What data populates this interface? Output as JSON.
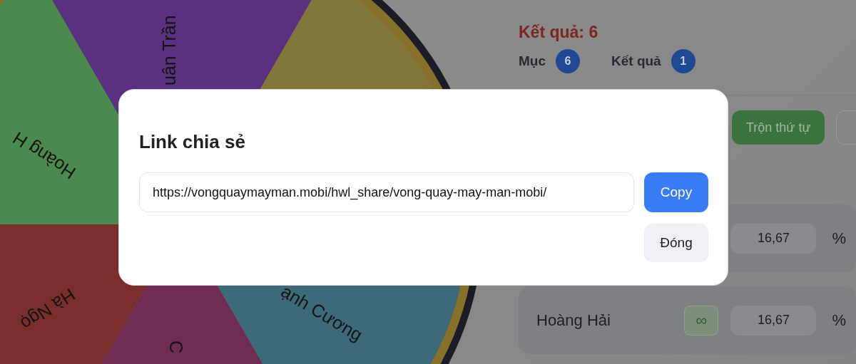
{
  "wheel": {
    "slices": [
      {
        "color": "#4a8a4e",
        "label": "Hoàng H"
      },
      {
        "color": "#5a317e",
        "label": "uân Trần"
      },
      {
        "color": "#81773a"
      },
      {
        "color": "#3c6a78",
        "label": "ạnh Cương"
      },
      {
        "color": "#6f2c52",
        "label": "C"
      },
      {
        "color": "#7a2e2b",
        "label": "Hà Ngọ"
      }
    ]
  },
  "result": {
    "title": "Kết quả: 6"
  },
  "counters": [
    {
      "label": "Mục",
      "count": "6"
    },
    {
      "label": "Kết quả",
      "count": "1"
    }
  ],
  "actions": [
    {
      "label": "Trộn thứ tự",
      "kind": "shuffle"
    },
    {
      "kind": "outline"
    }
  ],
  "entries": [
    {
      "percent": "16,67",
      "unit": "%"
    },
    {
      "name": "Hoàng Hải",
      "symbol": "∞",
      "percent": "16,67",
      "unit": "%"
    }
  ],
  "dialog": {
    "title": "Link chia sẻ",
    "url": "https://vongquaymayman.mobi/hwl_share/vong-quay-may-man-mobi/",
    "buttons": [
      {
        "label": "Copy",
        "kind": "primary"
      },
      {
        "label": "Đóng",
        "kind": "secondary"
      }
    ]
  }
}
